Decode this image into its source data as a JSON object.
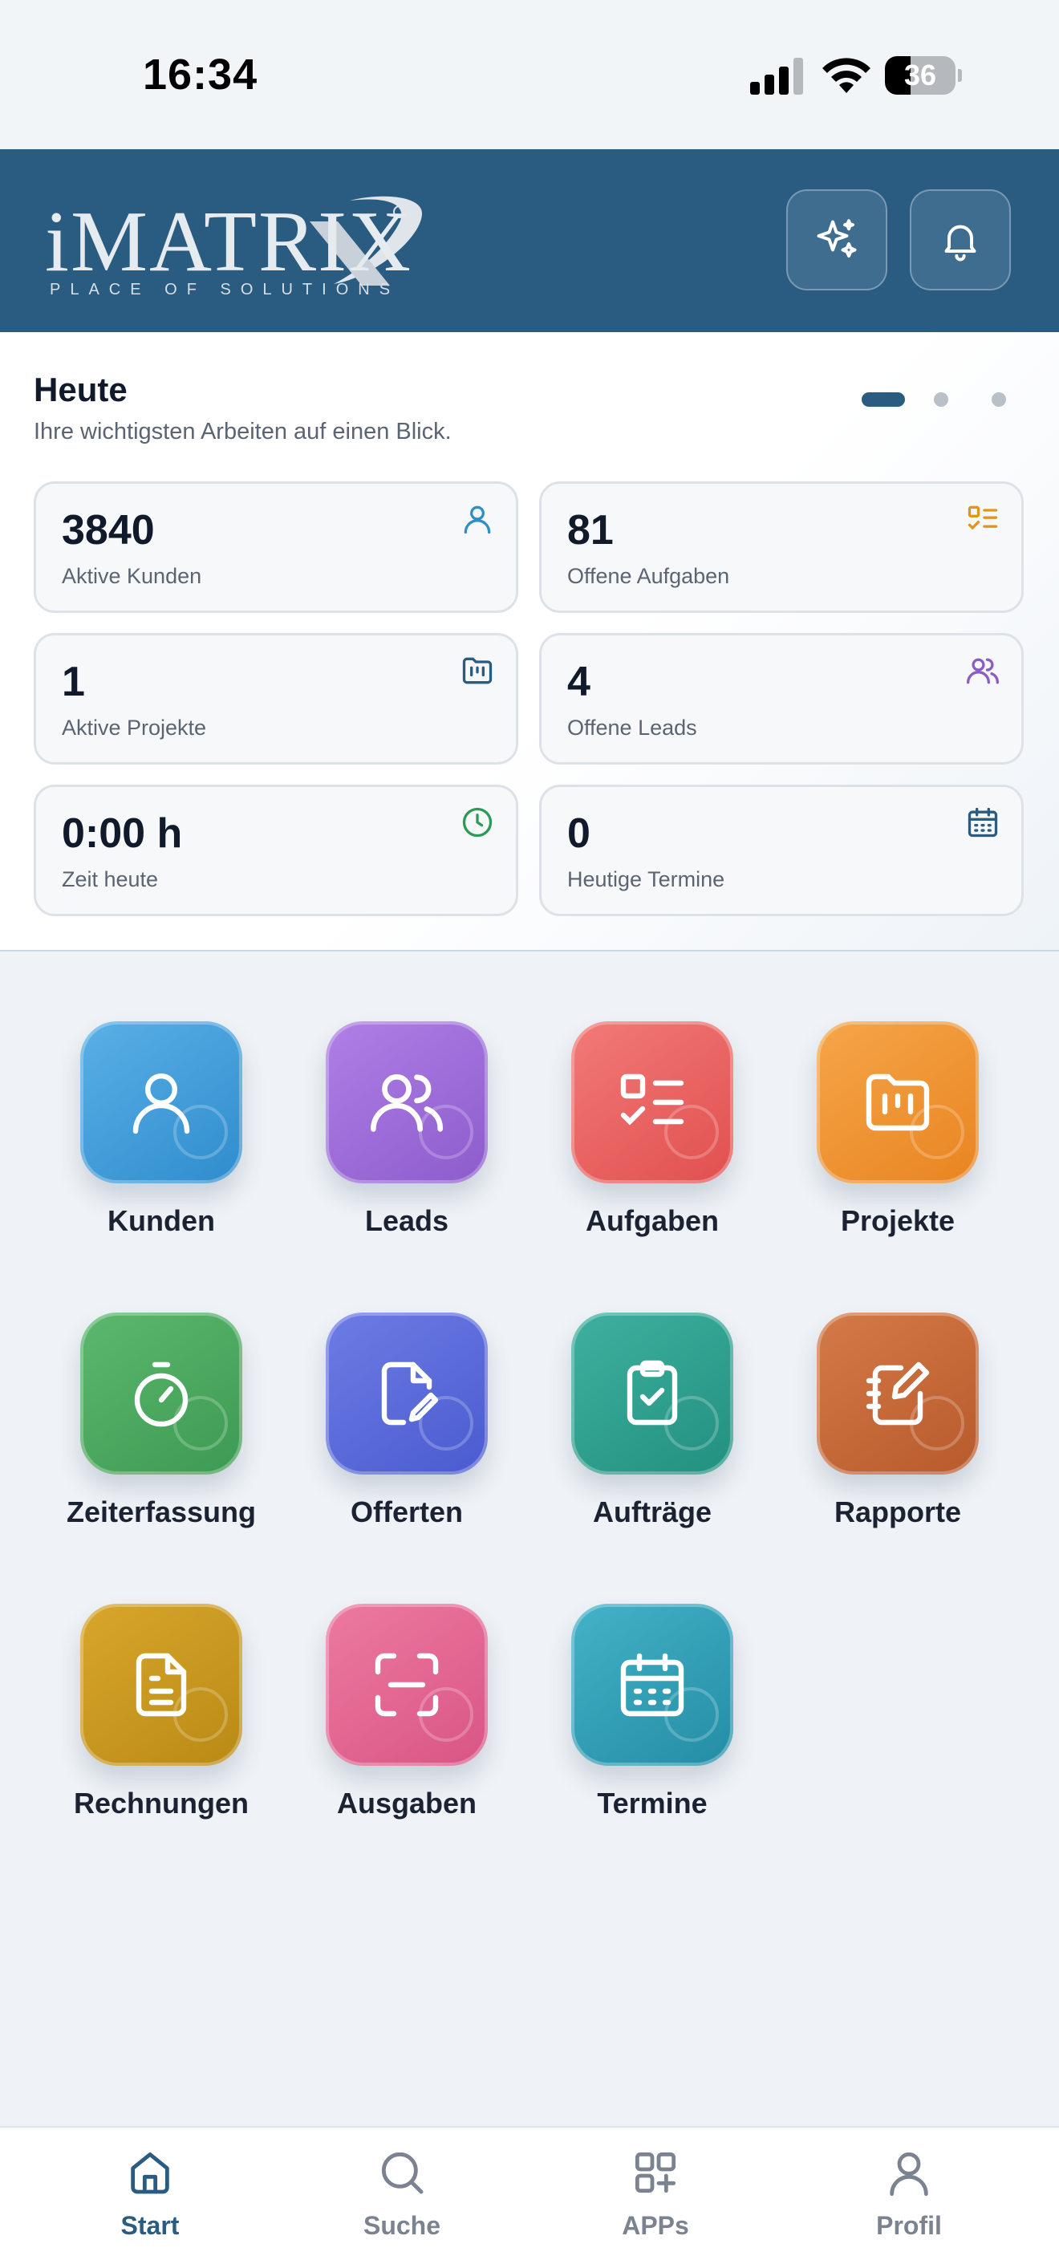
{
  "status_bar": {
    "time": "16:34",
    "battery": "36",
    "battery_level": 0.36
  },
  "header": {
    "logo_text": "iMATRIX",
    "logo_tagline": "PLACE OF SOLUTIONS",
    "buttons": [
      {
        "name": "ai-sparkle",
        "icon": "sparkles-icon"
      },
      {
        "name": "notifications",
        "icon": "bell-icon"
      }
    ]
  },
  "today": {
    "title": "Heute",
    "subtitle": "Ihre wichtigsten Arbeiten auf einen Blick.",
    "pager": {
      "pages": 3,
      "active": 0
    },
    "cards": [
      {
        "value": "3840",
        "label": "Aktive Kunden",
        "icon": "user-icon",
        "color": "#2e8fc7"
      },
      {
        "value": "81",
        "label": "Offene Aufgaben",
        "icon": "checklist-icon",
        "color": "#e2951c"
      },
      {
        "value": "1",
        "label": "Aktive Projekte",
        "icon": "project-icon",
        "color": "#2a5b80"
      },
      {
        "value": "4",
        "label": "Offene Leads",
        "icon": "users-icon",
        "color": "#8a5cc9"
      },
      {
        "value": "0:00 h",
        "label": "Zeit heute",
        "icon": "clock-icon",
        "color": "#2e9a57"
      },
      {
        "value": "0",
        "label": "Heutige Termine",
        "icon": "calendar-icon",
        "color": "#2a5b80"
      }
    ]
  },
  "apps": [
    {
      "label": "Kunden",
      "icon": "user-icon",
      "color": "#3b98d6"
    },
    {
      "label": "Leads",
      "icon": "users-icon",
      "color": "#9b6ad8"
    },
    {
      "label": "Aufgaben",
      "icon": "checklist-icon",
      "color": "#ec5f5f"
    },
    {
      "label": "Projekte",
      "icon": "folder-icon",
      "color": "#ee9128"
    },
    {
      "label": "Zeiterfassung",
      "icon": "stopwatch-icon",
      "color": "#46a55c"
    },
    {
      "label": "Offerten",
      "icon": "document-edit-icon",
      "color": "#5a6ad8"
    },
    {
      "label": "Aufträge",
      "icon": "clipboard-check-icon",
      "color": "#2a9b8a"
    },
    {
      "label": "Rapporte",
      "icon": "notebook-pen-icon",
      "color": "#c6693a"
    },
    {
      "label": "Rechnungen",
      "icon": "invoice-icon",
      "color": "#c9961e"
    },
    {
      "label": "Ausgaben",
      "icon": "scan-icon",
      "color": "#e2638f"
    },
    {
      "label": "Termine",
      "icon": "calendar-icon",
      "color": "#2e9db5"
    }
  ],
  "tabbar": [
    {
      "label": "Start",
      "icon": "home-icon",
      "active": true
    },
    {
      "label": "Suche",
      "icon": "search-icon",
      "active": false
    },
    {
      "label": "APPs",
      "icon": "apps-icon",
      "active": false
    },
    {
      "label": "Profil",
      "icon": "profile-icon",
      "active": false
    }
  ],
  "accent": "#2a5b80"
}
